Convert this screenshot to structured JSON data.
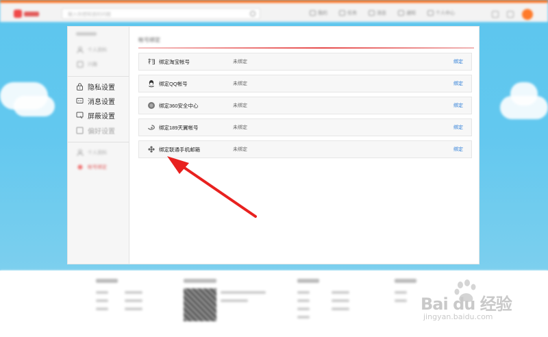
{
  "header": {
    "search_placeholder": "输入你想知道的问题",
    "nav": [
      "我的",
      "任务",
      "消息",
      "通知",
      "个人中心"
    ]
  },
  "sidebar": {
    "items": [
      {
        "label": "个人资料",
        "icon": "user-icon",
        "muted": true
      },
      {
        "label": "兴趣",
        "icon": "tag-icon",
        "muted": true
      },
      {
        "label": "隐私设置",
        "icon": "lock-icon",
        "muted": false
      },
      {
        "label": "消息设置",
        "icon": "message-icon",
        "muted": false
      },
      {
        "label": "屏蔽设置",
        "icon": "shield-icon",
        "muted": false
      },
      {
        "label": "偏好设置",
        "icon": "settings-icon",
        "muted": true
      },
      {
        "label": "个人资料",
        "icon": "user-icon",
        "muted": true
      },
      {
        "label": "帐号绑定",
        "icon": "link-icon",
        "muted": true
      }
    ]
  },
  "content": {
    "title": "帐号绑定",
    "rows": [
      {
        "icon": "taobao-icon",
        "label": "绑定淘宝帐号",
        "status": "未绑定",
        "action": "绑定"
      },
      {
        "icon": "qq-icon",
        "label": "绑定QQ帐号",
        "status": "未绑定",
        "action": "绑定"
      },
      {
        "icon": "360-icon",
        "label": "绑定360安全中心",
        "status": "未绑定",
        "action": "绑定"
      },
      {
        "icon": "tianyi-icon",
        "label": "绑定189天翼帐号",
        "status": "未绑定",
        "action": "绑定"
      },
      {
        "icon": "unicom-icon",
        "label": "绑定联通手机邮箱",
        "status": "未绑定",
        "action": "绑定"
      }
    ]
  },
  "watermark": {
    "brand": "Bai du 经验",
    "url": "jingyan.baidu.com"
  },
  "colors": {
    "accent": "#ff6a13",
    "link": "#2f7fd8",
    "arrow": "#e8211f",
    "title_rule": "#e64a4a"
  }
}
